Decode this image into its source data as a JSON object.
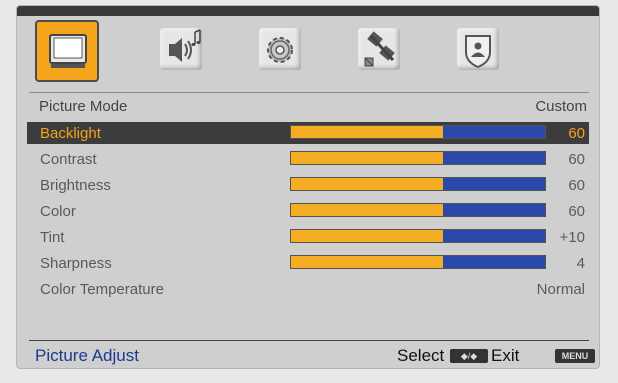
{
  "tabs": [
    {
      "icon": "tv-picture-icon",
      "active": true
    },
    {
      "icon": "speaker-music-icon",
      "active": false
    },
    {
      "icon": "gear-icon",
      "active": false
    },
    {
      "icon": "satellite-icon",
      "active": false
    },
    {
      "icon": "shield-parental-lock-icon",
      "active": false
    }
  ],
  "picture_mode": {
    "label": "Picture  Mode",
    "value": "Custom"
  },
  "rows": [
    {
      "label": "Backlight",
      "value": "60",
      "level": 0.6,
      "selected": true
    },
    {
      "label": "Contrast",
      "value": "60",
      "level": 0.6,
      "selected": false
    },
    {
      "label": "Brightness",
      "value": "60",
      "level": 0.6,
      "selected": false
    },
    {
      "label": "Color",
      "value": "60",
      "level": 0.6,
      "selected": false
    },
    {
      "label": "Tint",
      "value": "+10",
      "level": 0.6,
      "selected": false
    },
    {
      "label": "Sharpness",
      "value": "4",
      "level": 0.6,
      "selected": false
    }
  ],
  "color_temperature": {
    "label": "Color Temperature",
    "value": "Normal"
  },
  "status": {
    "title": "Picture Adjust",
    "select_label": "Select",
    "select_icon": "◆/◆",
    "exit_label": "Exit",
    "menu_icon": "MENU"
  },
  "colors": {
    "accent": "#f5ad23",
    "bar_blue": "#2b49a8",
    "selected_bg": "#3c3c3c",
    "title_blue": "#1a3a8c"
  }
}
